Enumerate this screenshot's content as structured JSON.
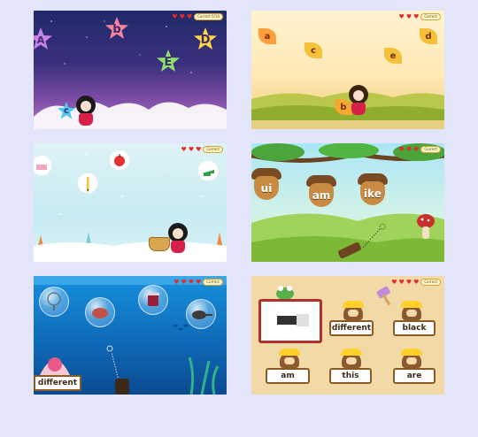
{
  "panels": [
    {
      "hud": {
        "hearts": [
          "♥",
          "♥",
          "♥"
        ],
        "counter": "Correct  0/10"
      },
      "letters": [
        "A",
        "b",
        "D",
        "E",
        "c"
      ]
    },
    {
      "hud": {
        "hearts": [
          "♥",
          "♥",
          "♥"
        ],
        "counter": "Correct"
      },
      "letters": [
        "a",
        "c",
        "e",
        "d",
        "b"
      ]
    },
    {
      "hud": {
        "hearts": [
          "♥",
          "♥",
          "♥"
        ],
        "counter": "Correct"
      }
    },
    {
      "hud": {
        "hearts": [
          "♥",
          "♥",
          "♥"
        ],
        "counter": "Correct"
      },
      "words": [
        "ui",
        "am",
        "ike"
      ]
    },
    {
      "hud": {
        "hearts": [
          "♥",
          "♥",
          "♥",
          "♥"
        ],
        "counter": "Correct"
      },
      "word": "different"
    },
    {
      "hud": {
        "hearts": [
          "♥",
          "♥",
          "♥",
          "♥"
        ],
        "counter": "Correct"
      },
      "words": [
        "different",
        "black",
        "am",
        "this",
        "are"
      ]
    }
  ],
  "colors": {
    "background": "#e3e6fb",
    "heart": "#e42a2a"
  }
}
